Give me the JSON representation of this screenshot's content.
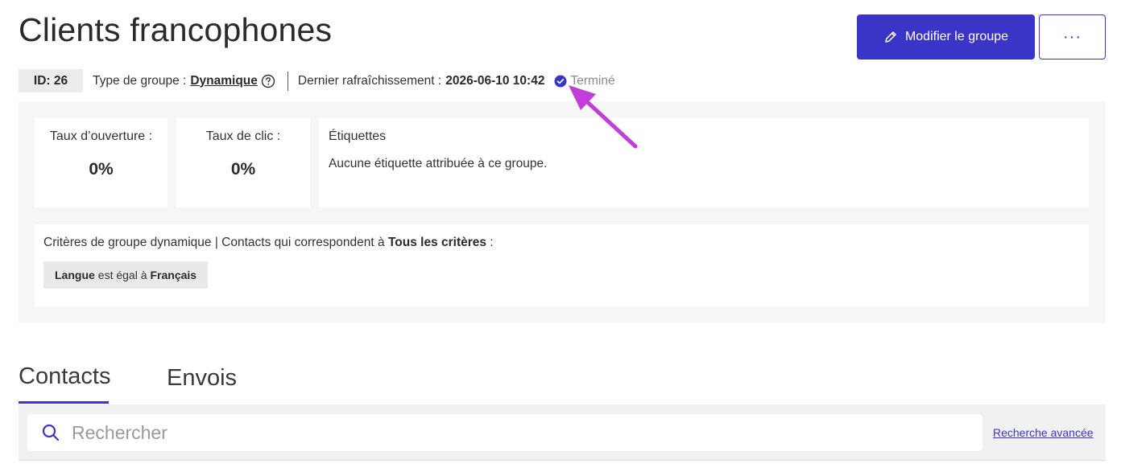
{
  "header": {
    "title": "Clients francophones",
    "edit_button": "Modifier le groupe",
    "more_button": "···"
  },
  "meta": {
    "id_badge": "ID: 26",
    "group_type_label": "Type de groupe :",
    "group_type_value": "Dynamique",
    "refresh_label": "Dernier rafraîchissement :",
    "refresh_value": "2026-06-10 10:42",
    "status": "Terminé"
  },
  "stats": {
    "open_rate_label": "Taux d’ouverture :",
    "open_rate_value": "0%",
    "click_rate_label": "Taux de clic :",
    "click_rate_value": "0%"
  },
  "tags": {
    "title": "Étiquettes",
    "empty_text": "Aucune étiquette attribuée à ce groupe."
  },
  "criteria": {
    "prefix": "Critères de groupe dynamique | Contacts qui correspondent à",
    "match_mode": "Tous les critères",
    "suffix": ":",
    "rule_field": "Langue",
    "rule_operator": "est égal à",
    "rule_value": "Français"
  },
  "tabs": [
    {
      "label": "Contacts",
      "active": true
    },
    {
      "label": "Envois",
      "active": false
    }
  ],
  "search": {
    "placeholder": "Rechercher",
    "advanced_link": "Recherche avancée"
  },
  "colors": {
    "accent": "#3b35c7",
    "annotation_arrow": "#c23ed8",
    "panel_bg": "#f6f6f6"
  }
}
